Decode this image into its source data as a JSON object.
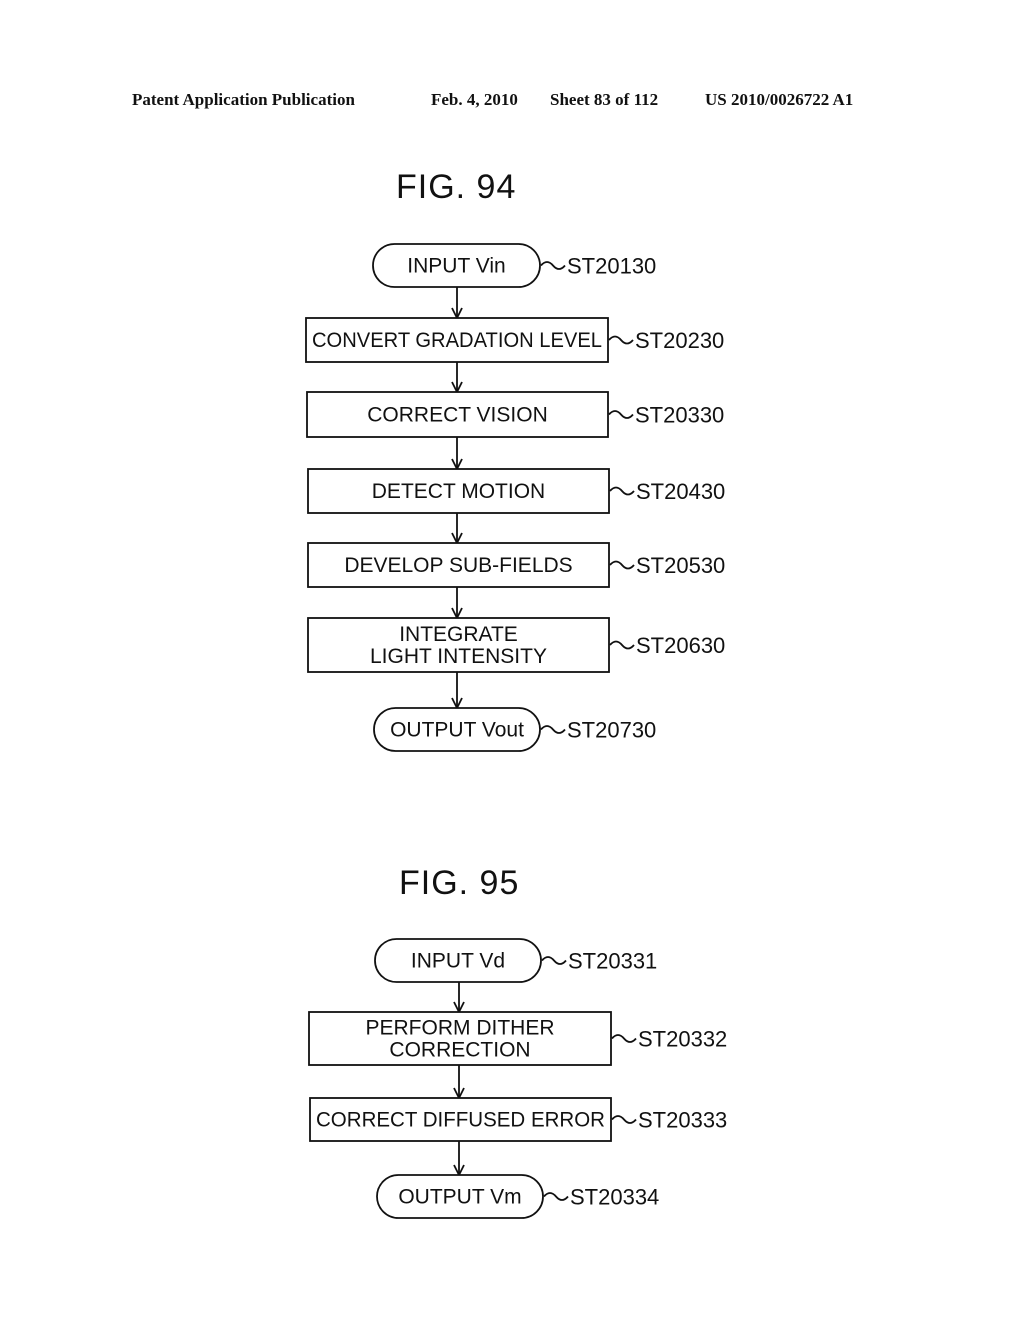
{
  "header": {
    "publication": "Patent Application Publication",
    "date": "Feb. 4, 2010",
    "sheet": "Sheet 83 of 112",
    "number": "US 2010/0026722 A1"
  },
  "figures": [
    {
      "title": "FIG. 94",
      "steps": [
        {
          "shape": "terminal",
          "lines": [
            "INPUT Vin"
          ],
          "ref": "ST20130"
        },
        {
          "shape": "process",
          "lines": [
            "CONVERT GRADATION LEVEL"
          ],
          "ref": "ST20230"
        },
        {
          "shape": "process",
          "lines": [
            "CORRECT VISION"
          ],
          "ref": "ST20330"
        },
        {
          "shape": "process",
          "lines": [
            "DETECT MOTION"
          ],
          "ref": "ST20430"
        },
        {
          "shape": "process",
          "lines": [
            "DEVELOP SUB-FIELDS"
          ],
          "ref": "ST20530"
        },
        {
          "shape": "process",
          "lines": [
            "INTEGRATE",
            "LIGHT INTENSITY"
          ],
          "ref": "ST20630"
        },
        {
          "shape": "terminal",
          "lines": [
            "OUTPUT Vout"
          ],
          "ref": "ST20730"
        }
      ]
    },
    {
      "title": "FIG. 95",
      "steps": [
        {
          "shape": "terminal",
          "lines": [
            "INPUT Vd"
          ],
          "ref": "ST20331"
        },
        {
          "shape": "process",
          "lines": [
            "PERFORM DITHER",
            "CORRECTION"
          ],
          "ref": "ST20332"
        },
        {
          "shape": "process",
          "lines": [
            "CORRECT DIFFUSED ERROR"
          ],
          "ref": "ST20333"
        },
        {
          "shape": "terminal",
          "lines": [
            "OUTPUT Vm"
          ],
          "ref": "ST20334"
        }
      ]
    }
  ]
}
